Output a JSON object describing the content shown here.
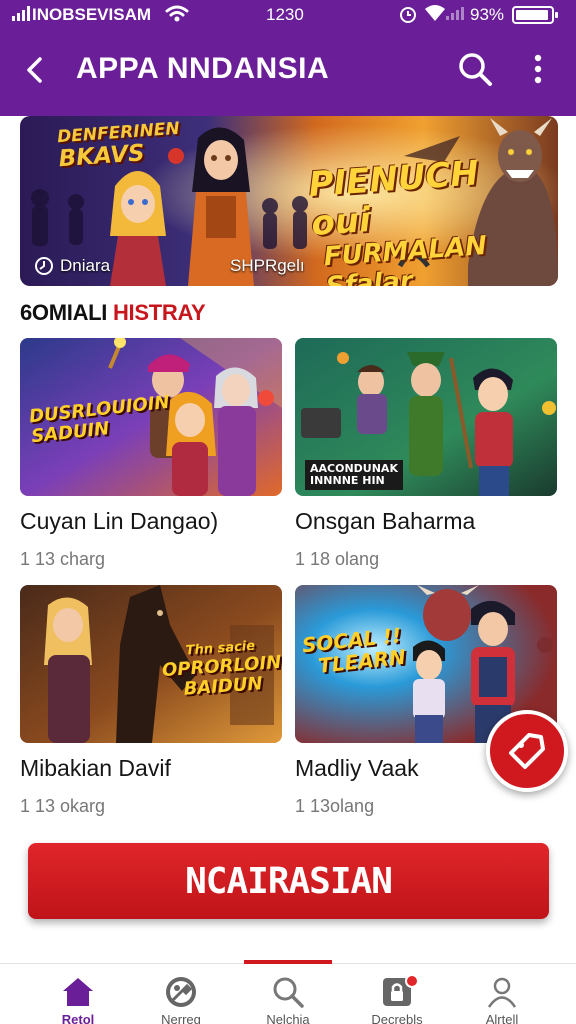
{
  "status_bar": {
    "carrier": "INOBSEVISAM",
    "time": "1230",
    "battery_pct": "93%",
    "battery_level": 0.93
  },
  "header": {
    "title": "APPA NNDANSIA",
    "back_icon": "back-arrow-icon",
    "search_icon": "search-icon",
    "more_icon": "more-vertical-icon"
  },
  "hero": {
    "logo_line1": "DENFERINEN",
    "logo_line2": "BKAVS",
    "title_line1": "PIENUCH oui",
    "title_line2": "FURMALAN Sfalar",
    "caption_left": "Dniara",
    "caption_right": "SHPRgelı"
  },
  "section": {
    "title_a": "6OMIALI ",
    "title_b": "HISTRAY",
    "accent_color": "#c8161d"
  },
  "cards": [
    {
      "name": "Cuyan Lin Dangao)",
      "meta": "1 13 charg",
      "caption_l1": "DUSRLOUIOIN",
      "caption_l2": "SADUIN"
    },
    {
      "name": "Onsgan Baharma",
      "meta": "1 18 olang",
      "caption_l1": "AACONDUNAK",
      "caption_l2": "INNNNE HIN"
    },
    {
      "name": "Mibakian Davif",
      "meta": "1 13 okarg",
      "caption_l1": "Thn sacie",
      "caption_l2": "OPRORLOIN",
      "caption_l3": "BAIDUN"
    },
    {
      "name": "Madliy Vaak",
      "meta": "1 13olang",
      "caption_l1": "SOCAL !!",
      "caption_l2": "TLEARN"
    }
  ],
  "cta": {
    "label": "NCAIRASIAN"
  },
  "bottom_nav": [
    {
      "label": "Retol",
      "icon": "home-icon",
      "active": true
    },
    {
      "label": "Nerreg",
      "icon": "tools-icon",
      "active": false
    },
    {
      "label": "Nelchia",
      "icon": "search-icon",
      "active": false
    },
    {
      "label": "Decrebls",
      "icon": "lock-icon",
      "active": false
    },
    {
      "label": "Alrtell",
      "icon": "profile-icon",
      "active": false
    }
  ],
  "colors": {
    "brand_purple": "#6a1f98",
    "brand_red": "#d0181f"
  }
}
